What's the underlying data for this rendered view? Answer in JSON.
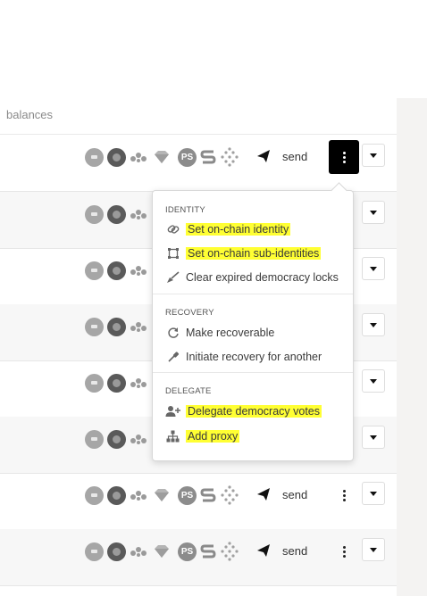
{
  "header": {
    "label": "balances"
  },
  "send_label": "send",
  "ps_label": "PS",
  "colors": {
    "highlight": "#ffff33",
    "gutter": "#f4f3f2"
  },
  "menu": {
    "sections": [
      {
        "title": "IDENTITY",
        "items": [
          {
            "label": "Set on-chain identity",
            "icon": "link-icon",
            "highlighted": true
          },
          {
            "label": "Set on-chain sub-identities",
            "icon": "object-group-icon",
            "highlighted": true
          },
          {
            "label": "Clear expired democracy locks",
            "icon": "broom-icon",
            "highlighted": false
          }
        ]
      },
      {
        "title": "RECOVERY",
        "items": [
          {
            "label": "Make recoverable",
            "icon": "redo-icon",
            "highlighted": false
          },
          {
            "label": "Initiate recovery for another",
            "icon": "screwdriver-icon",
            "highlighted": false
          }
        ]
      },
      {
        "title": "DELEGATE",
        "items": [
          {
            "label": "Delegate democracy votes",
            "icon": "user-plus-icon",
            "highlighted": true
          },
          {
            "label": "Add proxy",
            "icon": "sitemap-icon",
            "highlighted": true
          }
        ]
      }
    ]
  }
}
